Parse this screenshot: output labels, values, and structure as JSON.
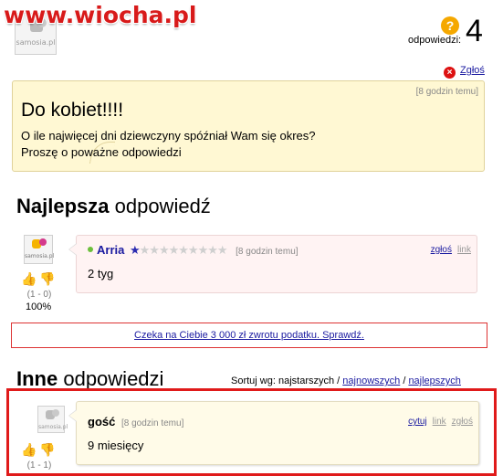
{
  "watermark": {
    "text": "www.wiocha.pl"
  },
  "avatar_logo_text": "samosia.pl",
  "stats": {
    "answers_label": "odpowiedzi:",
    "answers_count": "4",
    "question_icon": "question-icon"
  },
  "report_link": "Zgłoś",
  "question": {
    "time": "[8 godzin temu]",
    "title": "Do kobiet!!!!",
    "body_line1": "O ile najwięcej dni dziewczyny spóźniał Wam się okres?",
    "body_line2": "Proszę o poważne odpowiedzi"
  },
  "best_section": {
    "bold": "Najlepsza",
    "rest": " odpowiedź"
  },
  "best_answer": {
    "author": "Arria",
    "stars": "★★★★★★★★★★",
    "rating_level": 0.1,
    "time": "[8 godzin temu]",
    "report": "zgłoś",
    "link": "link",
    "text": "2 tyg",
    "votes": "(1 - 0)",
    "percent": "100%"
  },
  "ad": {
    "text": "Czeka na Ciebie 3 000 zł zwrotu podatku. Sprawdź."
  },
  "others_section": {
    "bold": "Inne",
    "rest": " odpowiedzi"
  },
  "sort": {
    "label": "Sortuj wg: ",
    "option1": "najstarszych",
    "sep": " / ",
    "option2": "najnowszych",
    "option3": "najlepszych"
  },
  "other_answer": {
    "author": "gość",
    "time": "[8 godzin temu]",
    "quote": "cytuj",
    "link": "link",
    "report": "zgłoś",
    "text": "9 miesięcy",
    "votes": "(1 - 1)"
  },
  "colors": {
    "accent_red": "#e01a1a",
    "link_blue": "#1a1aa0",
    "question_bg": "#fff8d3",
    "best_bg": "#fff3f3"
  }
}
